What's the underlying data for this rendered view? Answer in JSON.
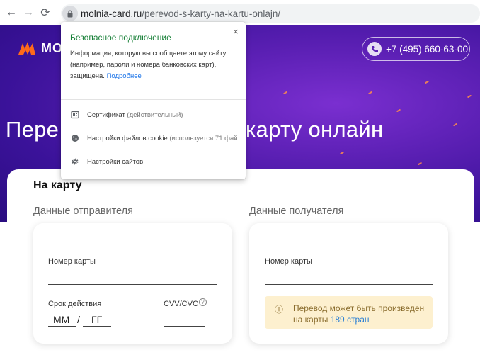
{
  "browser": {
    "back_glyph": "←",
    "forward_glyph": "→",
    "reload_glyph": "⟳",
    "url_domain": "molnia-card.ru",
    "url_path": "/perevod-s-karty-na-kartu-onlajn/"
  },
  "header": {
    "logo_text": "МО",
    "phone": "+7 (495) 660-63-00"
  },
  "hero": {
    "title_left": "Пере",
    "title_right": "карту онлайн"
  },
  "form": {
    "section_title": "На карту",
    "sender_label": "Данные отправителя",
    "recipient_label": "Данные получателя",
    "sender_card": {
      "card_number_label": "Номер карты",
      "expiry_label": "Срок действия",
      "expiry_month_placeholder": "ММ",
      "expiry_separator": "/",
      "expiry_year_placeholder": "ГГ",
      "cvv_label": "CVV/CVC",
      "cvv_help": "?"
    },
    "recipient_card": {
      "card_number_label": "Номер карты",
      "info_icon": "ⓘ",
      "info_text": "Перевод может быть произведен на карты ",
      "info_link": "189 стран"
    }
  },
  "popup": {
    "title": "Безопасное подключение",
    "close_glyph": "×",
    "description": "Информация, которую вы сообщаете этому сайту (например, пароли и номера банковских карт), защищена. ",
    "more_link": "Подробнее",
    "items": [
      {
        "label": "Сертификат",
        "detail": " (действительный)",
        "icon": "certificate-icon"
      },
      {
        "label": "Настройки файлов cookie",
        "detail": " (используется 71 фай",
        "icon": "cookie-icon"
      },
      {
        "label": "Настройки сайтов",
        "detail": "",
        "icon": "gear-icon"
      }
    ]
  },
  "colors": {
    "hero_purple": "#4a1aa8",
    "accent_orange": "#ff6a1a",
    "secure_green": "#188038",
    "link_blue": "#1a73e8",
    "info_bg": "#fdf0cf"
  }
}
